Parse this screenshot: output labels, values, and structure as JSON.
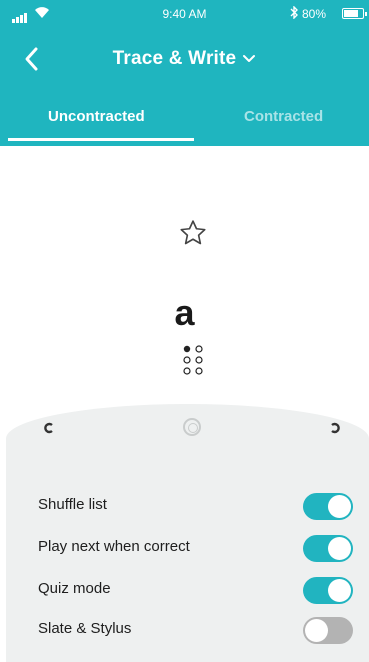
{
  "status_bar": {
    "time": "9:40 AM",
    "battery": "80%"
  },
  "header": {
    "title": "Trace & Write",
    "tabs": [
      {
        "label": "Uncontracted",
        "selected": true
      },
      {
        "label": "Contracted",
        "selected": false
      }
    ]
  },
  "content": {
    "letter": "a"
  },
  "settings": {
    "items": [
      {
        "label": "Shuffle list",
        "enabled": true
      },
      {
        "label": "Play next when correct",
        "enabled": true
      },
      {
        "label": "Quiz mode",
        "enabled": true
      },
      {
        "label": "Slate & Stylus",
        "enabled": false
      }
    ]
  },
  "colors": {
    "accent": "#1fb5bf",
    "toggle_on": "#21b4c0",
    "toggle_off": "#b3b3b3",
    "sheet": "#eef0f0"
  }
}
